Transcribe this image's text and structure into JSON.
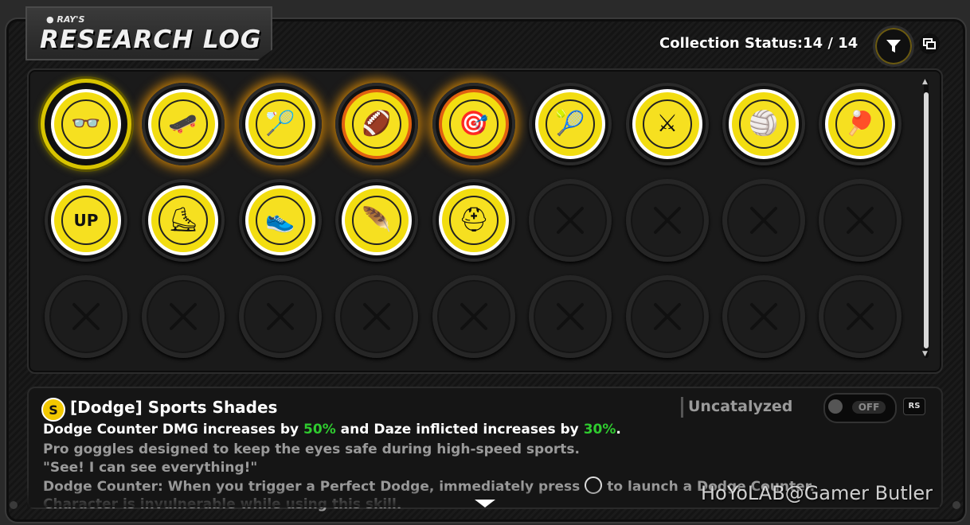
{
  "header": {
    "logo_small": "● RAY'S",
    "logo_big": "RESEARCH LOG",
    "collection_status": "Collection Status:14 / 14"
  },
  "icons": {
    "filter": "funnel-icon",
    "copy": "window-copy-icon",
    "info_title_icon": "dodge-category-icon",
    "empty_slot": "x-icon"
  },
  "items": [
    {
      "name": "sports-shades",
      "glyph": "👓",
      "state": "selected",
      "border": "white"
    },
    {
      "name": "skateboard",
      "glyph": "🛹",
      "state": "glow",
      "border": "white"
    },
    {
      "name": "shuttlecock",
      "glyph": "🏸",
      "state": "glow",
      "border": "white"
    },
    {
      "name": "rugby-ball",
      "glyph": "🏈",
      "state": "glow",
      "border": "orange"
    },
    {
      "name": "darts",
      "glyph": "🎯",
      "state": "glow",
      "border": "orange"
    },
    {
      "name": "tennis-racket",
      "glyph": "🎾",
      "state": "normal",
      "border": "white"
    },
    {
      "name": "fencing-swords",
      "glyph": "⚔",
      "state": "normal",
      "border": "white"
    },
    {
      "name": "volleyball",
      "glyph": "🏐",
      "state": "normal",
      "border": "white"
    },
    {
      "name": "ping-pong-paddle",
      "glyph": "🏓",
      "state": "normal",
      "border": "white"
    },
    {
      "name": "up-badge",
      "glyph": "UP",
      "state": "normal",
      "border": "white"
    },
    {
      "name": "roller-skate",
      "glyph": "⛸",
      "state": "normal",
      "border": "white"
    },
    {
      "name": "sneaker",
      "glyph": "👟",
      "state": "normal",
      "border": "white"
    },
    {
      "name": "shuttlecock-feathers",
      "glyph": "🪶",
      "state": "normal",
      "border": "white"
    },
    {
      "name": "football-helmet",
      "glyph": "⛑",
      "state": "normal",
      "border": "white"
    }
  ],
  "empty_slots": 13,
  "info": {
    "category_glyph": "S",
    "title": "[Dodge] Sports Shades",
    "catalyzed_label": "Uncatalyzed",
    "toggle_label": "OFF",
    "rs_label": "RS",
    "line1_a": "Dodge Counter DMG increases by ",
    "line1_b": "50%",
    "line1_c": " and Daze inflicted increases by ",
    "line1_d": "30%",
    "line1_e": ".",
    "line2": "Pro goggles designed to keep the eyes safe during high-speed sports.",
    "line3": "\"See! I can see everything!\"",
    "line4_a": "Dodge Counter: When you trigger a Perfect Dodge, immediately press",
    "line4_b": "to launch a Dodge Counter.",
    "line5": "Character is invulnerable while using this skill."
  },
  "watermark": "HoYoLAB@Gamer Butler",
  "colors": {
    "accent_yellow": "#f2dd10",
    "highlight_green": "#2fcb2f",
    "glow_orange": "#ffa000"
  }
}
